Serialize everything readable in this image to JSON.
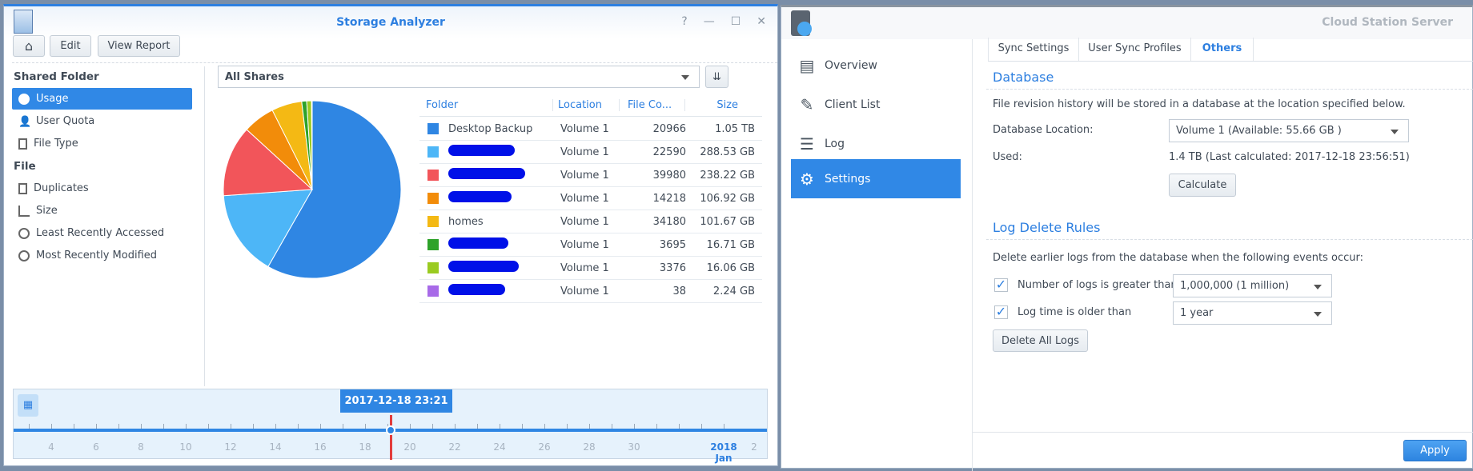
{
  "storage_analyzer": {
    "title": "Storage Analyzer",
    "toolbar": {
      "edit": "Edit",
      "view_report": "View Report"
    },
    "window_controls": [
      "?",
      "—",
      "☐",
      "✕"
    ],
    "sidebar": {
      "shared_folder_header": "Shared Folder",
      "shared_items": [
        {
          "label": "Usage",
          "icon": "pie-chart-icon",
          "active": true
        },
        {
          "label": "User Quota",
          "icon": "user-icon"
        },
        {
          "label": "File Type",
          "icon": "file-icon"
        }
      ],
      "file_header": "File",
      "file_items": [
        {
          "label": "Duplicates",
          "icon": "duplicate-icon"
        },
        {
          "label": "Size",
          "icon": "size-icon"
        },
        {
          "label": "Least Recently Accessed",
          "icon": "clock-icon"
        },
        {
          "label": "Most Recently Modified",
          "icon": "clock-icon"
        }
      ]
    },
    "share_select": "All Shares",
    "table": {
      "headers": [
        "Folder",
        "Location",
        "File Co...",
        "Size"
      ],
      "rows": [
        {
          "folder": "Desktop Backup",
          "location": "Volume 1",
          "count": "20966",
          "size": "1.05 TB",
          "color": "#2f86e3",
          "redacted": false
        },
        {
          "folder": "",
          "location": "Volume 1",
          "count": "22590",
          "size": "288.53 GB",
          "color": "#4db6f7",
          "redacted": true
        },
        {
          "folder": "",
          "location": "Volume 1",
          "count": "39980",
          "size": "238.22 GB",
          "color": "#f2555a",
          "redacted": true
        },
        {
          "folder": "",
          "location": "Volume 1",
          "count": "14218",
          "size": "106.92 GB",
          "color": "#f28c0a",
          "redacted": true
        },
        {
          "folder": "homes",
          "location": "Volume 1",
          "count": "34180",
          "size": "101.67 GB",
          "color": "#f4b914",
          "redacted": false
        },
        {
          "folder": "",
          "location": "Volume 1",
          "count": "3695",
          "size": "16.71 GB",
          "color": "#2ea22a",
          "redacted": true
        },
        {
          "folder": "",
          "location": "Volume 1",
          "count": "3376",
          "size": "16.06 GB",
          "color": "#9acb21",
          "redacted": true
        },
        {
          "folder": "",
          "location": "Volume 1",
          "count": "38",
          "size": "2.24 GB",
          "color": "#a86ae8",
          "redacted": true
        }
      ]
    },
    "chart_data": {
      "type": "pie",
      "values_gb": [
        1075.2,
        288.53,
        238.22,
        106.92,
        101.67,
        16.71,
        16.06,
        2.24
      ]
    },
    "timeline": {
      "selected": "2017-12-18 23:21",
      "labels": [
        "4",
        "6",
        "8",
        "10",
        "12",
        "14",
        "16",
        "18",
        "20",
        "22",
        "24",
        "26",
        "28",
        "30"
      ],
      "year": "2018",
      "month": "Jan",
      "last": "2"
    }
  },
  "cloud_station": {
    "title": "Cloud Station Server",
    "nav": [
      {
        "label": "Overview"
      },
      {
        "label": "Client List"
      },
      {
        "label": "Log"
      },
      {
        "label": "Settings",
        "active": true
      }
    ],
    "tabs": [
      {
        "label": "Sync Settings"
      },
      {
        "label": "User Sync Profiles"
      },
      {
        "label": "Others",
        "active": true
      }
    ],
    "database": {
      "header": "Database",
      "desc": "File revision history will be stored in a database at the location specified below.",
      "location_label": "Database Location:",
      "location_value": "Volume 1 (Available: 55.66 GB )",
      "used_label": "Used:",
      "used_value": "1.4 TB (Last calculated: 2017-12-18 23:56:51)",
      "calculate": "Calculate"
    },
    "log_rules": {
      "header": "Log Delete Rules",
      "desc": "Delete earlier logs from the database when the following events occur:",
      "rule1_label": "Number of logs is greater than",
      "rule1_value": "1,000,000 (1 million)",
      "rule1_checked": true,
      "rule2_label": "Log time is older than",
      "rule2_value": "1 year",
      "rule2_checked": true,
      "delete_all": "Delete All Logs"
    },
    "apply": "Apply"
  }
}
